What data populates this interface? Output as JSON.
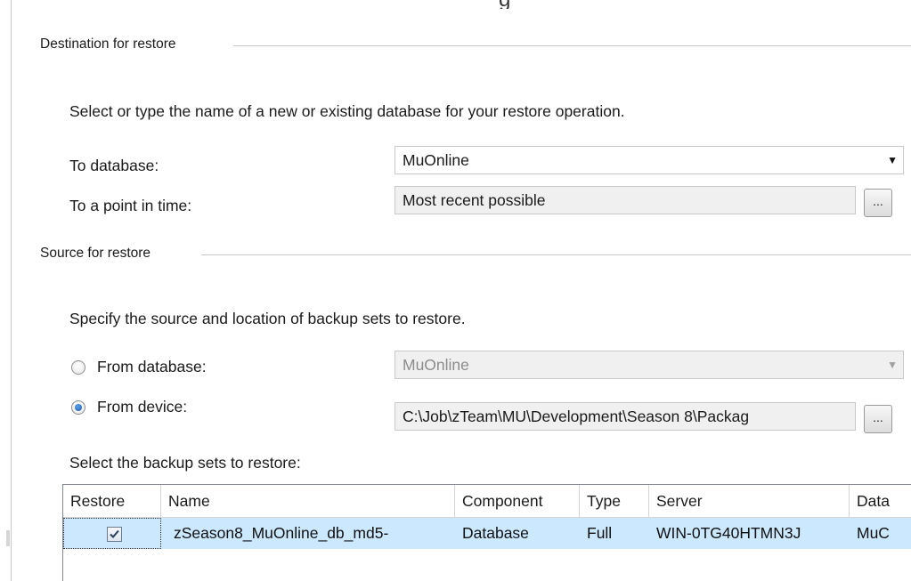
{
  "destination": {
    "title": "Destination for restore",
    "description": "Select or type the name of a new or existing database for your restore operation.",
    "to_database_label": "To database:",
    "to_database_value": "MuOnline",
    "point_in_time_label": "To a point in time:",
    "point_in_time_value": "Most recent possible",
    "ellipsis_label": "..."
  },
  "source": {
    "title": "Source for restore",
    "description": "Specify the source and location of backup sets to restore.",
    "from_database_label": "From database:",
    "from_database_value": "MuOnline",
    "from_device_label": "From device:",
    "from_device_value": "C:\\Job\\zTeam\\MU\\Development\\Season 8\\Packag",
    "selected_option": "from_device",
    "ellipsis_label": "..."
  },
  "backup_sets": {
    "label": "Select the backup sets to restore:",
    "columns": [
      "Restore",
      "Name",
      "Component",
      "Type",
      "Server",
      "Data"
    ],
    "rows": [
      {
        "restore": true,
        "name": "zSeason8_MuOnline_db_md5-",
        "component": "Database",
        "type": "Full",
        "server": "WIN-0TG40HTMN3J",
        "database": "MuC"
      }
    ]
  },
  "icons": {
    "dropdown": "chevron-down-icon",
    "checkmark": "checkmark-icon"
  },
  "colors": {
    "selected_row": "#cce8ff",
    "radio_dot": "#1d5fa8",
    "group_rule": "#c8c8c8"
  }
}
